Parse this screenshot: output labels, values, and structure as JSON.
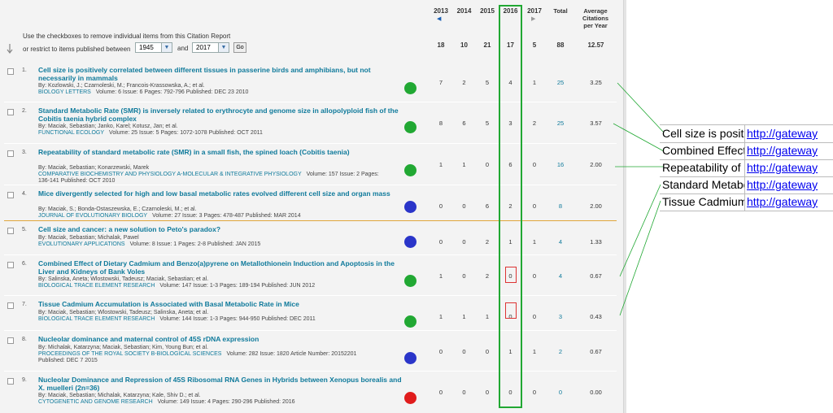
{
  "report": {
    "instruction_line1": "Use the checkboxes to remove individual items from this Citation Report",
    "instruction_line2": "or restrict to items published between",
    "year_from": "1945",
    "and_label": "and",
    "year_to": "2017",
    "go_label": "Go",
    "years": [
      "2013",
      "2014",
      "2015",
      "2016",
      "2017"
    ],
    "total_label": "Total",
    "avg_label_line1": "Average",
    "avg_label_line2": "Citations",
    "avg_label_line3": "per Year",
    "summary_counts": [
      "18",
      "10",
      "21",
      "17",
      "5"
    ],
    "summary_total": "88",
    "summary_avg": "12.57"
  },
  "rows": [
    {
      "num": "1.",
      "title": "Cell size is positively correlated between different tissues in passerine birds and amphibians, but not necessarily in mammals",
      "authors": "By: Kozlowski, J.; Czarnoleski, M.; Francois-Krassowska, A.; et al.",
      "journal": "BIOLOGY LETTERS",
      "details": "Volume: 6   Issue: 6   Pages: 792-796   Published: DEC 23 2010",
      "counts": [
        "7",
        "2",
        "5",
        "4",
        "1"
      ],
      "total": "25",
      "avg": "3.25",
      "dot": "#21a833"
    },
    {
      "num": "2.",
      "title": "Standard Metabolic Rate (SMR) is inversely related to erythrocyte and genome size in allopolyploid fish of the Cobitis taenia hybrid complex",
      "authors": "By: Maciak, Sebastian; Janko, Karel; Kotusz, Jan; et al.",
      "journal": "FUNCTIONAL ECOLOGY",
      "details": "Volume: 25   Issue: 5   Pages: 1072-1078   Published: OCT 2011",
      "counts": [
        "8",
        "6",
        "5",
        "3",
        "2"
      ],
      "total": "25",
      "avg": "3.57",
      "dot": "#21a833"
    },
    {
      "num": "3.",
      "title": "Repeatability of standard metabolic rate (SMR) in a small fish, the spined loach (Cobitis taenia)",
      "authors": "By: Maciak, Sebastian; Konarzewski, Marek",
      "journal": "COMPARATIVE BIOCHEMISTRY AND PHYSIOLOGY A-MOLECULAR & INTEGRATIVE PHYSIOLOGY",
      "details": "Volume: 157   Issue: 2   Pages:",
      "details2": "136-141   Published: OCT 2010",
      "counts": [
        "1",
        "1",
        "0",
        "6",
        "0"
      ],
      "total": "16",
      "avg": "2.00",
      "dot": "#21a833"
    },
    {
      "num": "4.",
      "title": "Mice divergently selected for high and low basal metabolic rates evolved different cell size and organ mass",
      "authors": "By: Maciak, S.; Bonda-Ostaszewska, E.; Czarnoleski, M.; et al.",
      "journal": "JOURNAL OF EVOLUTIONARY BIOLOGY",
      "details": "Volume: 27   Issue: 3   Pages: 478-487   Published: MAR 2014",
      "counts": [
        "0",
        "0",
        "6",
        "2",
        "0"
      ],
      "total": "8",
      "avg": "2.00",
      "dot": "#2a35c9"
    },
    {
      "num": "5.",
      "title": "Cell size and cancer: a new solution to Peto's paradox?",
      "authors": "By: Maciak, Sebastian; Michalak, Pawel",
      "journal": "EVOLUTIONARY APPLICATIONS",
      "details": "Volume: 8   Issue: 1   Pages: 2-8   Published: JAN 2015",
      "counts": [
        "0",
        "0",
        "2",
        "1",
        "1"
      ],
      "total": "4",
      "avg": "1.33",
      "dot": "#2a35c9"
    },
    {
      "num": "6.",
      "title": "Combined Effect of Dietary Cadmium and Benzo(a)pyrene on Metallothionein Induction and Apoptosis in the Liver and Kidneys of Bank Voles",
      "authors": "By: Salinska, Aneta; Wlostowski, Tadeusz; Maciak, Sebastian; et al.",
      "journal": "BIOLOGICAL TRACE ELEMENT RESEARCH",
      "details": "Volume: 147   Issue: 1-3   Pages: 189-194   Published: JUN 2012",
      "counts": [
        "1",
        "0",
        "2",
        "0",
        "0"
      ],
      "total": "4",
      "avg": "0.67",
      "dot": "#21a833"
    },
    {
      "num": "7.",
      "title": "Tissue Cadmium Accumulation is Associated with Basal Metabolic Rate in Mice",
      "authors": "By: Maciak, Sebastian; Wlostowski, Tadeusz; Salinska, Aneta; et al.",
      "journal": "BIOLOGICAL TRACE ELEMENT RESEARCH",
      "details": "Volume: 144   Issue: 1-3   Pages: 944-950   Published: DEC 2011",
      "counts": [
        "1",
        "1",
        "1",
        "0",
        "0"
      ],
      "total": "3",
      "avg": "0.43",
      "dot": "#21a833"
    },
    {
      "num": "8.",
      "title": "Nucleolar dominance and maternal control of 45S rDNA expression",
      "authors": "By: Michalak, Katarzyna; Maciak, Sebastian; Kim, Young Bun; et al.",
      "journal": "PROCEEDINGS OF THE ROYAL SOCIETY B-BIOLOGICAL SCIENCES",
      "details": "Volume: 282   Issue: 1820   Article Number: 20152201",
      "details2": "Published: DEC 7 2015",
      "counts": [
        "0",
        "0",
        "0",
        "1",
        "1"
      ],
      "total": "2",
      "avg": "0.67",
      "dot": "#2a35c9"
    },
    {
      "num": "9.",
      "title": "Nucleolar Dominance and Repression of 45S Ribosomal RNA Genes in Hybrids between Xenopus borealis and X. muelleri (2n=36)",
      "authors": "By: Maciak, Sebastian; Michalak, Katarzyna; Kale, Shiv D.; et al.",
      "journal": "CYTOGENETIC AND GENOME RESEARCH",
      "details": "Volume: 149   Issue: 4   Pages: 290-296   Published: 2016",
      "counts": [
        "0",
        "0",
        "0",
        "0",
        "0"
      ],
      "total": "0",
      "avg": "0.00",
      "dot": "#e01c1c"
    }
  ],
  "side_table": [
    {
      "title": "Cell size is positively",
      "link": "http://gateway"
    },
    {
      "title": "Combined Effect",
      "link": "http://gateway"
    },
    {
      "title": "Repeatability of",
      "link": "http://gateway"
    },
    {
      "title": "Standard Metabolic",
      "link": "http://gateway"
    },
    {
      "title": "Tissue Cadmium",
      "link": "http://gateway"
    }
  ],
  "colors": {
    "highlight_green": "#21a833",
    "highlight_red": "#d33333",
    "link": "#0f7a9b",
    "separator": "#e0a53a"
  }
}
